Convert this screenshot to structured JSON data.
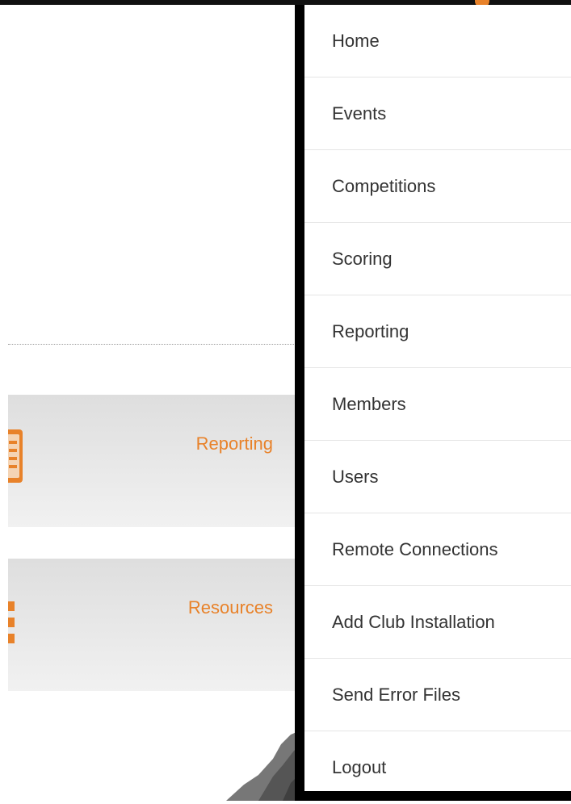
{
  "menu": {
    "items": [
      {
        "label": "Home"
      },
      {
        "label": "Events"
      },
      {
        "label": "Competitions"
      },
      {
        "label": "Scoring"
      },
      {
        "label": "Reporting"
      },
      {
        "label": "Members"
      },
      {
        "label": "Users"
      },
      {
        "label": "Remote Connections"
      },
      {
        "label": "Add Club Installation"
      },
      {
        "label": "Send Error Files"
      },
      {
        "label": "Logout"
      }
    ]
  },
  "dashboard": {
    "tiles": [
      {
        "label": "Reporting",
        "icon": "report-icon"
      },
      {
        "label": "Resources",
        "icon": "resources-icon"
      }
    ]
  },
  "colors": {
    "accent": "#e8822a",
    "menu_text": "#333333",
    "menu_border": "#000000",
    "tile_bg": "#e6e6e6"
  }
}
